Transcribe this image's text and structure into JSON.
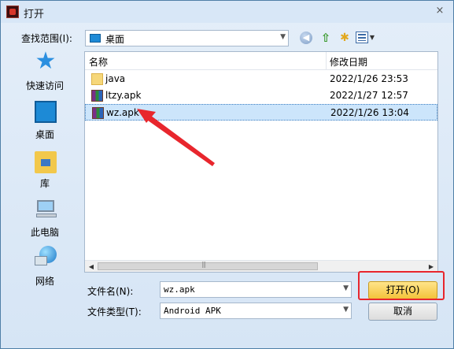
{
  "window": {
    "title": "打开",
    "close_glyph": "×"
  },
  "toolbar": {
    "look_in_label": "查找范围(I):",
    "look_in_value": "桌面",
    "icons": [
      "back-icon",
      "up-folder-icon",
      "new-folder-icon",
      "view-menu-icon"
    ]
  },
  "places": [
    {
      "label": "快速访问",
      "icon": "star-icon"
    },
    {
      "label": "桌面",
      "icon": "desktop-icon"
    },
    {
      "label": "库",
      "icon": "library-icon"
    },
    {
      "label": "此电脑",
      "icon": "computer-icon"
    },
    {
      "label": "网络",
      "icon": "network-icon"
    }
  ],
  "filelist": {
    "columns": [
      "名称",
      "修改日期"
    ],
    "rows": [
      {
        "name": "java",
        "date": "2022/1/26 23:53",
        "type": "folder",
        "selected": false
      },
      {
        "name": "ltzy.apk",
        "date": "2022/1/27 12:57",
        "type": "apk",
        "selected": false
      },
      {
        "name": "wz.apk",
        "date": "2022/1/26 13:04",
        "type": "apk",
        "selected": true
      }
    ]
  },
  "form": {
    "filename_label": "文件名(N):",
    "filename_value": "wz.apk",
    "filetype_label": "文件类型(T):",
    "filetype_value": "Android APK"
  },
  "buttons": {
    "open_label": "打开(O)",
    "cancel_label": "取消"
  },
  "annotation": {
    "color": "#e8262d"
  }
}
